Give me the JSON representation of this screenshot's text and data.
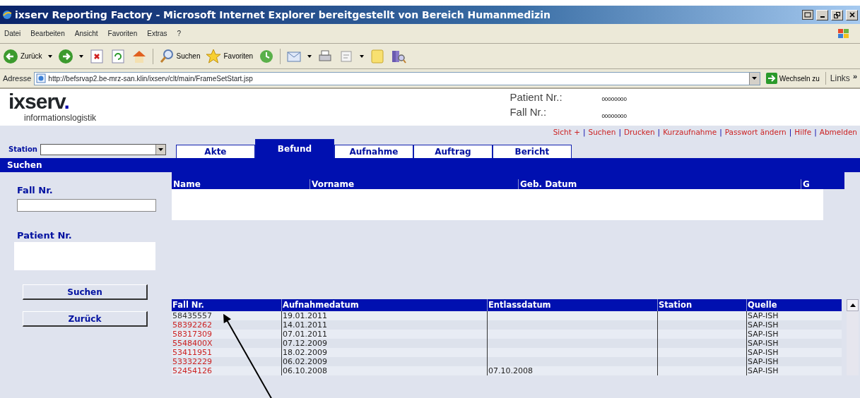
{
  "window": {
    "title": "ixserv Reporting Factory - Microsoft Internet Explorer bereitgestellt von Bereich Humanmedizin"
  },
  "menu": [
    "Datei",
    "Bearbeiten",
    "Ansicht",
    "Favoriten",
    "Extras",
    "?"
  ],
  "toolbar": [
    {
      "kind": "back",
      "label": "Zurück"
    },
    {
      "kind": "forward"
    },
    {
      "kind": "stop"
    },
    {
      "kind": "refresh"
    },
    {
      "kind": "home"
    },
    {
      "kind": "search",
      "label": "Suchen"
    },
    {
      "kind": "favorites",
      "label": "Favoriten"
    },
    {
      "kind": "history"
    },
    {
      "kind": "mail"
    },
    {
      "kind": "print"
    },
    {
      "kind": "edit"
    },
    {
      "kind": "note"
    },
    {
      "kind": "research"
    }
  ],
  "address": {
    "label": "Adresse",
    "value": "http://befsrvap2.be-mrz-san.klin/ixserv/clt/main/FrameSetStart.jsp",
    "go": "Wechseln zu",
    "links": "Links",
    "more": "»"
  },
  "header": {
    "logo": "ixserv.",
    "tagline": "informationslogistik",
    "patient_label": "Patient Nr.:",
    "patient_value": "00000000",
    "case_label": "Fall Nr.:",
    "case_value": "00000000"
  },
  "nav_links": [
    "Sicht +",
    "Suchen",
    "Drucken",
    "Kurzaufnahme",
    "Passwort ändern",
    "Hilfe",
    "Abmelden"
  ],
  "nav_separator": "|",
  "station": {
    "label": "Station"
  },
  "tabs": [
    {
      "label": "Akte",
      "selected": false
    },
    {
      "label": "Befund",
      "selected": true
    },
    {
      "label": "Aufnahme",
      "selected": false
    },
    {
      "label": "Auftrag",
      "selected": false
    },
    {
      "label": "Bericht",
      "selected": false
    }
  ],
  "section_title": "Suchen",
  "search_form": {
    "fields": [
      {
        "label": "Fall Nr."
      },
      {
        "label": "Patient Nr."
      }
    ],
    "buttons": [
      "Suchen",
      "Zurück"
    ]
  },
  "patients_table": {
    "columns": [
      "Name",
      "Vorname",
      "Geb. Datum",
      "G"
    ]
  },
  "cases_table": {
    "columns": [
      "Fall Nr.",
      "Aufnahmedatum",
      "Entlassdatum",
      "Station",
      "Quelle"
    ],
    "rows": [
      {
        "selected": true,
        "cells": [
          "58435557",
          "19.01.2011",
          "",
          "",
          "SAP-ISH"
        ]
      },
      {
        "selected": false,
        "cells": [
          "58392262",
          "14.01.2011",
          "",
          "",
          "SAP-ISH"
        ]
      },
      {
        "selected": false,
        "cells": [
          "58317309",
          "07.01.2011",
          "",
          "",
          "SAP-ISH"
        ]
      },
      {
        "selected": false,
        "cells": [
          "5548400X",
          "07.12.2009",
          "",
          "",
          "SAP-ISH"
        ]
      },
      {
        "selected": false,
        "cells": [
          "53411951",
          "18.02.2009",
          "",
          "",
          "SAP-ISH"
        ]
      },
      {
        "selected": false,
        "cells": [
          "53332229",
          "06.02.2009",
          "",
          "",
          "SAP-ISH"
        ]
      },
      {
        "selected": false,
        "cells": [
          "52454126",
          "06.10.2008",
          "07.10.2008",
          "",
          "SAP-ISH"
        ]
      }
    ]
  }
}
